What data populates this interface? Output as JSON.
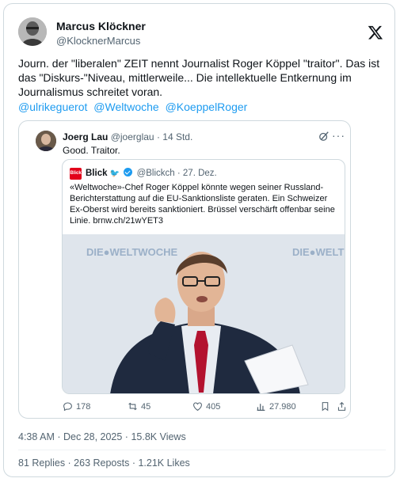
{
  "author": {
    "name": "Marcus Klöckner",
    "handle": "@KlocknerMarcus"
  },
  "x_logo_icon": "x-logo-icon",
  "tweet": {
    "text": "Journ. der \"liberalen\" ZEIT nennt Journalist Roger Köppel \"traitor\". Das ist das \"Diskurs-\"Niveau, mittlerweile... Die intellektuelle Entkernung im Journalismus schreitet voran.",
    "mentions": [
      "@ulrikeguerot",
      "@Weltwoche",
      "@KoeppelRoger"
    ]
  },
  "quote": {
    "name": "Joerg Lau",
    "handle": "@joerglau",
    "time": "· 14 Std.",
    "text": "Good. Traitor.",
    "inner": {
      "logo_text": "Blick",
      "name": "Blick",
      "handle": "@Blickch",
      "date": "· 27. Dez.",
      "text": "«Weltwoche»-Chef Roger Köppel könnte wegen seiner Russland-Berichterstattung auf die EU-Sanktionsliste geraten. Ein Schweizer Ex-Oberst wird bereits sanktioniert. Brüssel verschärft offenbar seine Linie.  brnw.ch/21wYET3",
      "photo_banner": "DIE●WELTWOCHE",
      "photo_banner_right": "DIE●WELT"
    },
    "actions": {
      "replies": "178",
      "reposts": "45",
      "likes": "405",
      "views": "27.980"
    }
  },
  "meta": {
    "timestamp": "4:38 AM · Dec 28, 2025 · 15.8K Views"
  },
  "stats": {
    "line": "81 Replies · 263 Reposts · 1.21K Likes"
  },
  "colors": {
    "link": "#1d9bf0",
    "muted": "#536471",
    "blick_red": "#e2001a",
    "tie_red": "#b3122f"
  }
}
